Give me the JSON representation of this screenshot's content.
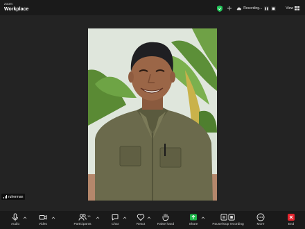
{
  "brand": {
    "small": "zoom",
    "big": "Workplace"
  },
  "header": {
    "recording_text": "Recording...",
    "view_label": "View"
  },
  "participant": {
    "name": "ruherman"
  },
  "toolbar": {
    "audio": "Audio",
    "video": "Video",
    "participants": "Participants",
    "participants_count": "19",
    "chat": "Chat",
    "react": "React",
    "raise_hand": "Raise hand",
    "share": "Share",
    "pause_stop_recording": "Pause/stop recording",
    "more": "More",
    "end": "End"
  },
  "colors": {
    "share_green": "#1eb84b",
    "end_red": "#e5252e",
    "secure_green": "#23c75a"
  }
}
